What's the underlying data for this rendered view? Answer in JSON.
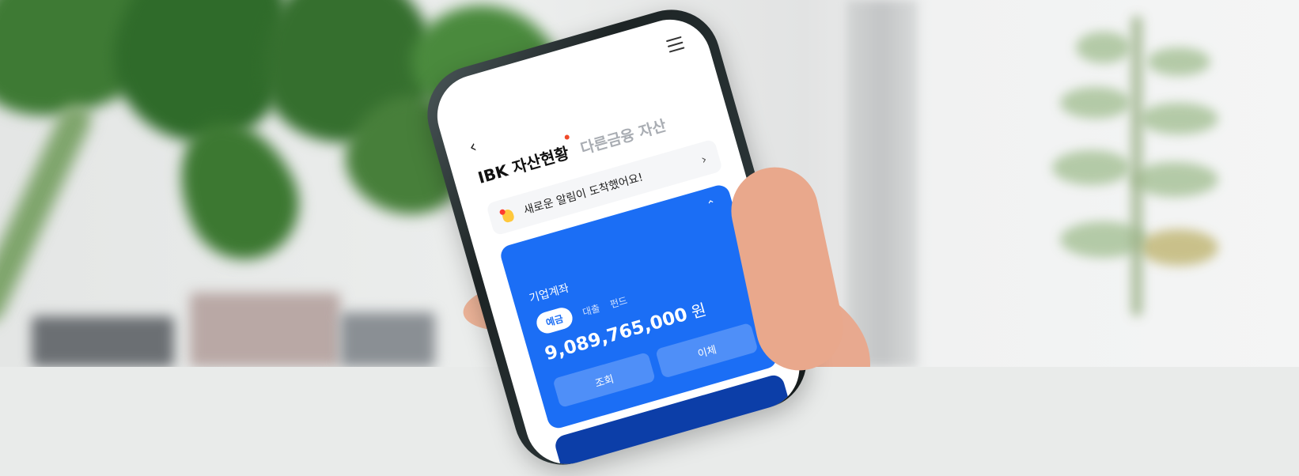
{
  "app": {
    "back_icon": "chevron-left-icon",
    "menu_icon": "hamburger-menu-icon"
  },
  "tabs": {
    "active": "IBK 자산현황",
    "other": "다른금융 자산"
  },
  "notice": {
    "text": "새로운 알림이 도착했어요!",
    "icon": "bell-icon",
    "arrow": "›"
  },
  "account_card": {
    "collapse_icon": "chevron-up-icon",
    "title": "기업계좌",
    "subtabs": [
      "예금",
      "대출",
      "펀드"
    ],
    "selected_subtab": "예금",
    "amount": "9,089,765,000",
    "unit": "원",
    "buttons": {
      "inquiry": "조회",
      "transfer": "이체"
    },
    "color": "#1b6ef5"
  },
  "colors": {
    "accent_blue": "#1b6ef5",
    "notification_dot": "#f04a2a"
  }
}
